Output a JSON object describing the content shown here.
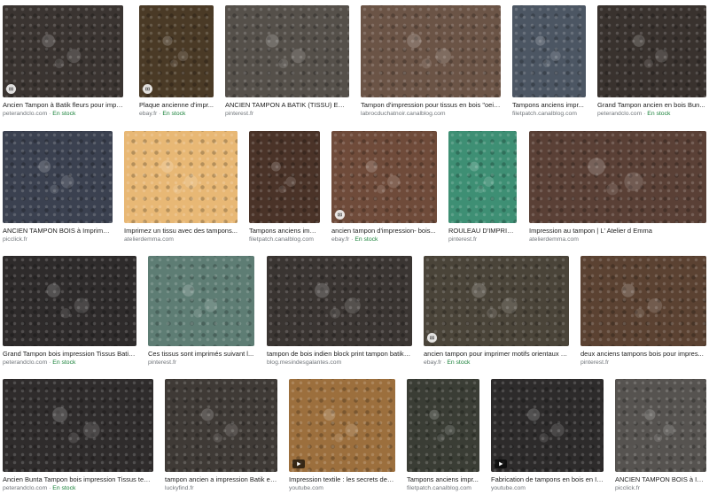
{
  "results": [
    {
      "title": "Ancien Tampon à Batik fleurs pour impre...",
      "source": "peterandclo.com",
      "stock": "En stock",
      "icon": "image-badge-icon",
      "color": "#3a3431"
    },
    {
      "title": "Plaque ancienne d'impr...",
      "source": "ebay.fr",
      "stock": "En stock",
      "icon": "image-badge-icon",
      "color": "#4a3a26"
    },
    {
      "title": "ANCIEN TAMPON A BATIK (TISSU) EN B...",
      "source": "pinterest.fr",
      "stock": "",
      "icon": "",
      "color": "#55504a"
    },
    {
      "title": "Tampon d'impression pour tissus en bois \"oeill...",
      "source": "labrocduchatnoir.canalblog.com",
      "stock": "",
      "icon": "",
      "color": "#6b5446"
    },
    {
      "title": "Tampons anciens impr...",
      "source": "filetpatch.canalblog.com",
      "stock": "",
      "icon": "",
      "color": "#4c5663"
    },
    {
      "title": "Grand Tampon ancien en bois Bun...",
      "source": "peterandclo.com",
      "stock": "En stock",
      "icon": "",
      "color": "#39322e"
    },
    {
      "title": "ANCIEN TAMPON BOIS à Imprimer T...",
      "source": "picclick.fr",
      "stock": "",
      "icon": "",
      "color": "#3b4150"
    },
    {
      "title": "Imprimez un tissu avec des tampons...",
      "source": "atelierdemma.com",
      "stock": "",
      "icon": "",
      "color": "#e8b875"
    },
    {
      "title": "Tampons anciens impr...",
      "source": "filetpatch.canalblog.com",
      "stock": "",
      "icon": "",
      "color": "#4a3328"
    },
    {
      "title": "ancien tampon d'impression- bois...",
      "source": "ebay.fr",
      "stock": "En stock",
      "icon": "image-badge-icon",
      "color": "#6f4b3a"
    },
    {
      "title": "ROULEAU D'IMPRIMERI...",
      "source": "pinterest.fr",
      "stock": "",
      "icon": "",
      "color": "#3e8f74"
    },
    {
      "title": "Impression au tampon | L' Atelier d Emma",
      "source": "atelierdemma.com",
      "stock": "",
      "icon": "",
      "color": "#5a4036"
    },
    {
      "title": "Grand Tampon bois impression Tissus Batik...",
      "source": "peterandclo.com",
      "stock": "En stock",
      "icon": "",
      "color": "#2e2b2b"
    },
    {
      "title": "Ces tissus sont imprimés suivant l...",
      "source": "pinterest.fr",
      "stock": "",
      "icon": "",
      "color": "#5e7d74"
    },
    {
      "title": "tampon de bois indien block print tampon batik d...",
      "source": "blog.mesindesgalantes.com",
      "stock": "",
      "icon": "",
      "color": "#3a3532"
    },
    {
      "title": "ancien tampon pour imprimer motifs orientaux s...",
      "source": "ebay.fr",
      "stock": "En stock",
      "icon": "image-badge-icon",
      "color": "#4a4439"
    },
    {
      "title": "deux anciens tampons bois pour impres...",
      "source": "pinterest.fr",
      "stock": "",
      "icon": "",
      "color": "#5b4232"
    },
    {
      "title": "Ancien Bunta Tampon bois impression Tissus texti...",
      "source": "peterandclo.com",
      "stock": "En stock",
      "icon": "",
      "color": "#2f2c2c"
    },
    {
      "title": "tampon ancien a impression Batik et...",
      "source": "luckyfind.fr",
      "stock": "",
      "icon": "",
      "color": "#3f3a36"
    },
    {
      "title": "Impression textile : les secrets de f...",
      "source": "youtube.com",
      "stock": "",
      "icon": "play-icon",
      "color": "#9c6f3d"
    },
    {
      "title": "Tampons anciens impr...",
      "source": "filetpatch.canalblog.com",
      "stock": "",
      "icon": "",
      "color": "#3a3d35"
    },
    {
      "title": "Fabrication de tampons en bois en In...",
      "source": "youtube.com",
      "stock": "",
      "icon": "play-icon",
      "color": "#2d2b2b"
    },
    {
      "title": "ANCIEN TAMPON BOIS à Im...",
      "source": "picclick.fr",
      "stock": "",
      "icon": "",
      "color": "#565350"
    }
  ]
}
